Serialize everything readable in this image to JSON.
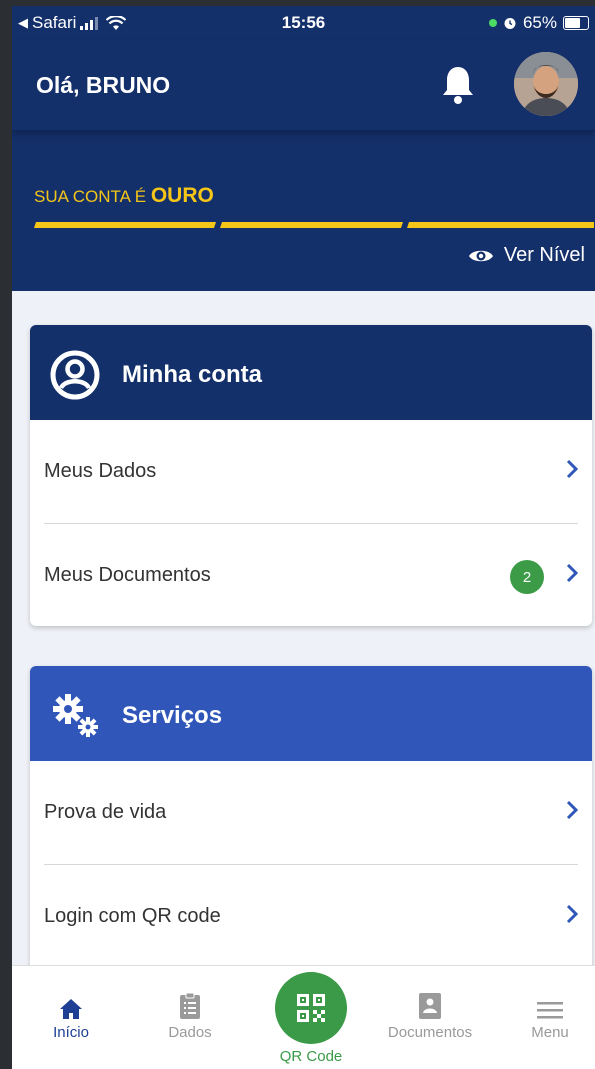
{
  "status_bar": {
    "back_app": "Safari",
    "time": "15:56",
    "battery": "65%"
  },
  "header": {
    "greeting": "Olá, BRUNO",
    "level_prefix": "SUA CONTA É",
    "level_name": "OURO",
    "ver_nivel": "Ver Nível"
  },
  "minha_conta": {
    "title": "Minha conta",
    "items": [
      {
        "label": "Meus Dados"
      },
      {
        "label": "Meus Documentos",
        "badge": "2"
      }
    ]
  },
  "servicos": {
    "title": "Serviços",
    "items": [
      {
        "label": "Prova de vida"
      },
      {
        "label": "Login com QR code"
      }
    ]
  },
  "tabbar": {
    "inicio": "Início",
    "dados": "Dados",
    "qrcode": "QR Code",
    "documentos": "Documentos",
    "menu": "Menu"
  },
  "colors": {
    "navy": "#14306b",
    "blue": "#2f56b8",
    "gold": "#f5c518",
    "green": "#3a9a47",
    "active_tab": "#1f3f95"
  }
}
